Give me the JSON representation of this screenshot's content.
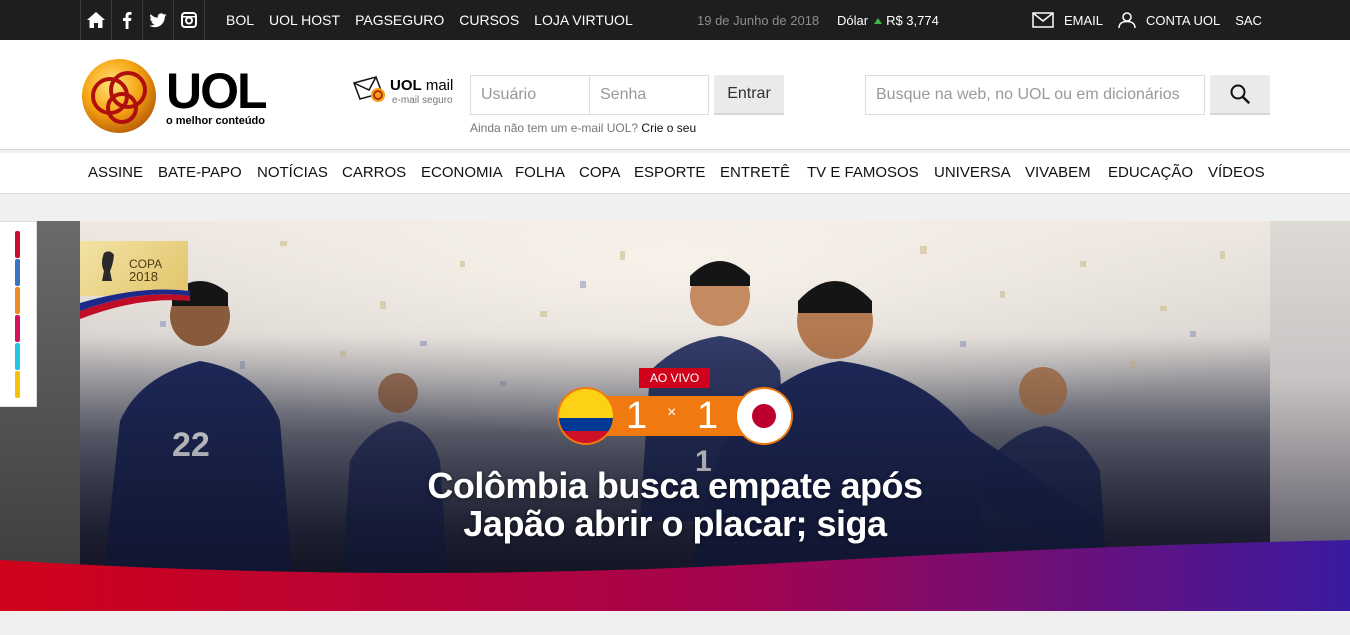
{
  "topbar": {
    "social": [
      "home-icon",
      "facebook-icon",
      "twitter-icon",
      "instagram-icon"
    ],
    "links": [
      "BOL",
      "UOL HOST",
      "PAGSEGURO",
      "CURSOS",
      "LOJA VIRTUOL"
    ],
    "date": "19 de Junho de 2018",
    "dolar_label": "Dólar",
    "dolar_value": "R$ 3,774",
    "email_label": "EMAIL",
    "conta_label": "CONTA UOL",
    "sac_label": "SAC"
  },
  "header": {
    "logo_word": "UOL",
    "logo_tagline": "o melhor conteúdo",
    "mail_brand_bold": "UOL",
    "mail_brand": "mail",
    "mail_sub": "e-mail seguro",
    "user_placeholder": "Usuário",
    "pass_placeholder": "Senha",
    "login_button": "Entrar",
    "signup_text": "Ainda não tem um e-mail UOL?",
    "signup_link": "Crie o seu",
    "search_placeholder": "Busque na web, no UOL ou em dicionários"
  },
  "nav": {
    "items": [
      "ASSINE",
      "BATE-PAPO",
      "NOTÍCIAS",
      "CARROS",
      "ECONOMIA",
      "FOLHA",
      "COPA",
      "ESPORTE",
      "ENTRETÊ",
      "TV E FAMOSOS",
      "UNIVERSA",
      "VIVABEM",
      "EDUCAÇÃO",
      "VÍDEOS"
    ]
  },
  "side_strip": {
    "colors": [
      "#c8102e",
      "#3b73c4",
      "#f08a24",
      "#d6105a",
      "#22c4e4",
      "#f5c20a"
    ]
  },
  "hero": {
    "badge_line1": "COPA",
    "badge_line2": "2018",
    "live_label": "AO VIVO",
    "score_home": "1",
    "score_sep": "×",
    "score_away": "1",
    "headline_line1": "Colômbia busca empate após",
    "headline_line2": "Japão abrir o placar; siga"
  },
  "colors": {
    "topbar": "#1e1e1e",
    "live_red": "#d0021b",
    "score_orange": "#f07a10",
    "wave_start": "#d0021b",
    "wave_end": "#3a1aa0"
  }
}
